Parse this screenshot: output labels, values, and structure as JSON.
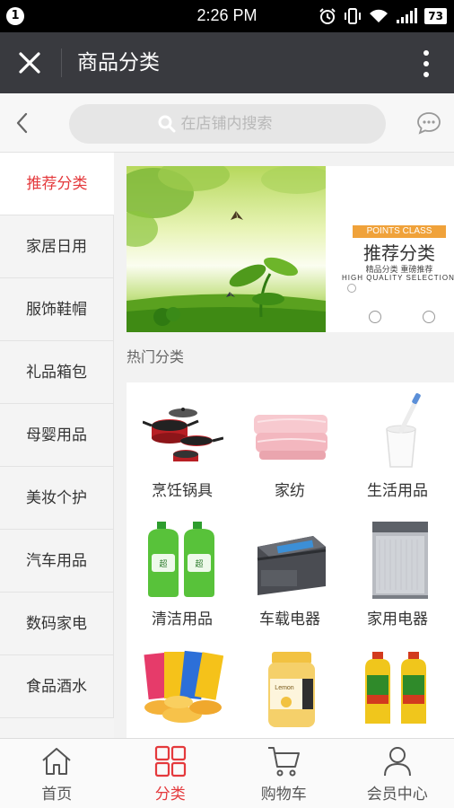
{
  "status_bar": {
    "notification_count": "1",
    "time": "2:26 PM",
    "battery": "73",
    "icons": [
      "alarm-icon",
      "vibrate-icon",
      "wifi-icon",
      "signal-icon",
      "battery-icon"
    ]
  },
  "title_bar": {
    "title": "商品分类",
    "close_icon": "close-icon",
    "more_icon": "more-vertical-icon"
  },
  "search": {
    "placeholder": "在店铺内搜索",
    "back_icon": "chevron-left-icon",
    "chat_icon": "chat-bubble-icon"
  },
  "left_nav": {
    "items": [
      {
        "label": "推荐分类",
        "active": true
      },
      {
        "label": "家居日用",
        "active": false
      },
      {
        "label": "服饰鞋帽",
        "active": false
      },
      {
        "label": "礼品箱包",
        "active": false
      },
      {
        "label": "母婴用品",
        "active": false
      },
      {
        "label": "美妆个护",
        "active": false
      },
      {
        "label": "汽车用品",
        "active": false
      },
      {
        "label": "数码家电",
        "active": false
      },
      {
        "label": "食品酒水",
        "active": false
      }
    ]
  },
  "banner": {
    "tag": "POINTS CLASS",
    "title": "推荐分类",
    "subtitle": "精品分类    重磅推荐",
    "tagline": "HIGH QUALITY SELECTION"
  },
  "section": {
    "title": "热门分类"
  },
  "categories": [
    {
      "label": "烹饪锅具",
      "icon": "cookware-icon"
    },
    {
      "label": "家纺",
      "icon": "bedding-icon"
    },
    {
      "label": "生活用品",
      "icon": "toothbrush-cup-icon"
    },
    {
      "label": "清洁用品",
      "icon": "detergent-bottles-icon"
    },
    {
      "label": "车载电器",
      "icon": "car-fridge-icon"
    },
    {
      "label": "家用电器",
      "icon": "dishwasher-icon"
    },
    {
      "label": "",
      "icon": "potato-chips-icon"
    },
    {
      "label": "",
      "icon": "honey-jar-icon"
    },
    {
      "label": "",
      "icon": "cooking-oil-icon"
    }
  ],
  "tab_bar": {
    "tabs": [
      {
        "label": "首页",
        "icon": "home-icon",
        "active": false
      },
      {
        "label": "分类",
        "icon": "grid-icon",
        "active": true
      },
      {
        "label": "购物车",
        "icon": "cart-icon",
        "active": false
      },
      {
        "label": "会员中心",
        "icon": "user-icon",
        "active": false
      }
    ]
  },
  "colors": {
    "accent": "#e4393c",
    "title_bar": "#393a3f",
    "banner_tag": "#f0a23a"
  }
}
